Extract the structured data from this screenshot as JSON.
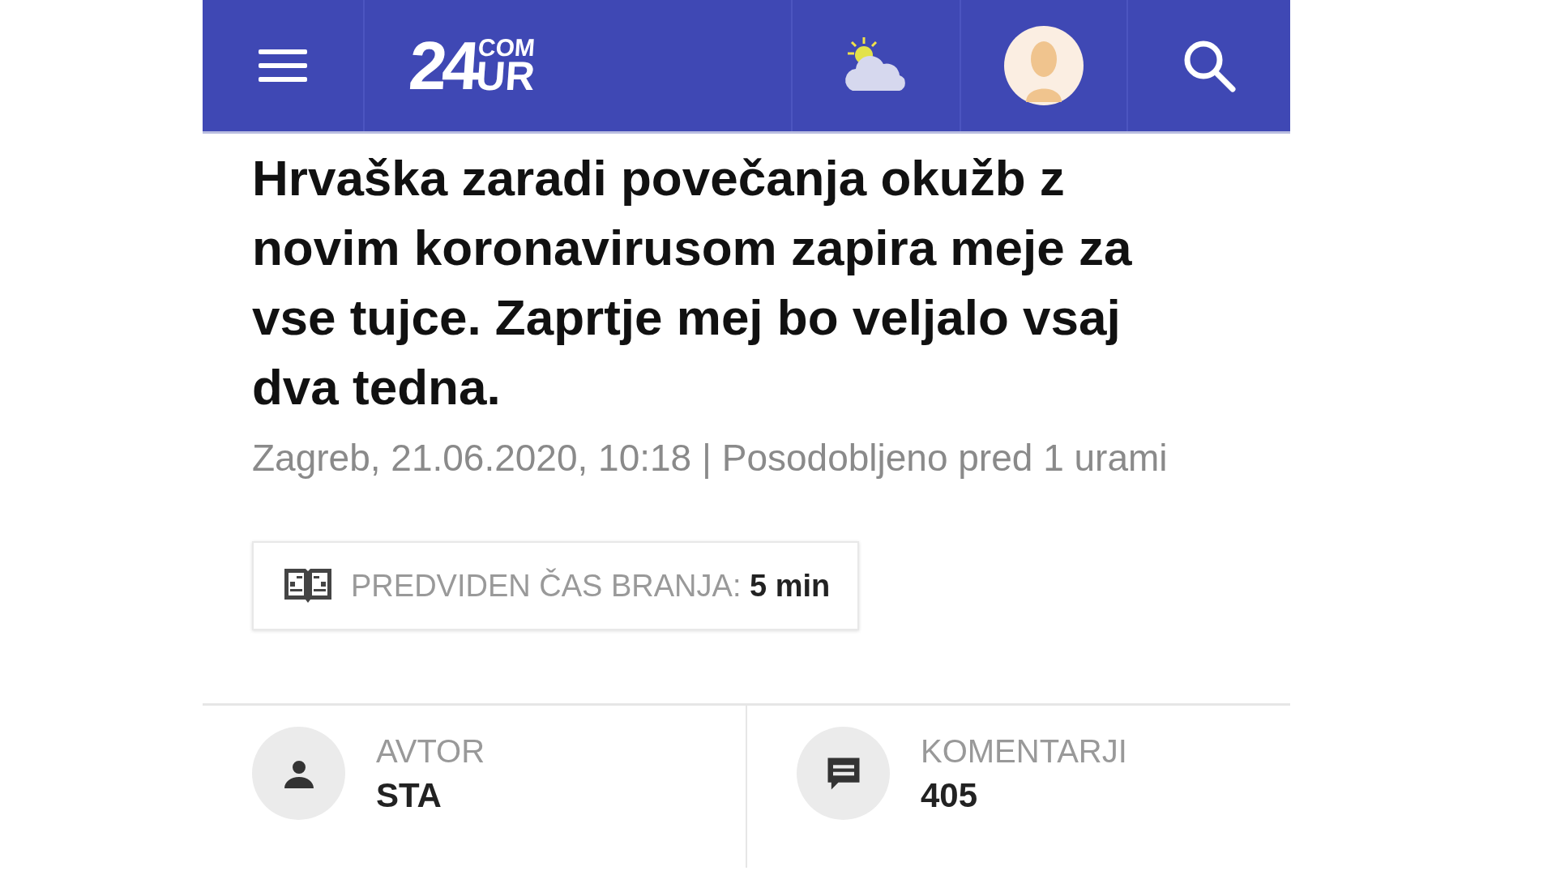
{
  "header": {
    "logo": {
      "number": "24",
      "top": "COM",
      "bottom": "UR"
    }
  },
  "article": {
    "title": "Hrvaška zaradi povečanja okužb z novim koronavirusom zapira meje za vse tujce. Zaprtje mej bo veljalo vsaj dva tedna.",
    "meta": "Zagreb, 21.06.2020, 10:18 | Posodobljeno pred 1 urami",
    "reading_time": {
      "label": "PREDVIDEN ČAS BRANJA:",
      "value": "5 min"
    }
  },
  "info": [
    {
      "kind": "author",
      "label": "AVTOR",
      "value": "STA"
    },
    {
      "kind": "comments",
      "label": "KOMENTARJI",
      "value": "405"
    }
  ]
}
